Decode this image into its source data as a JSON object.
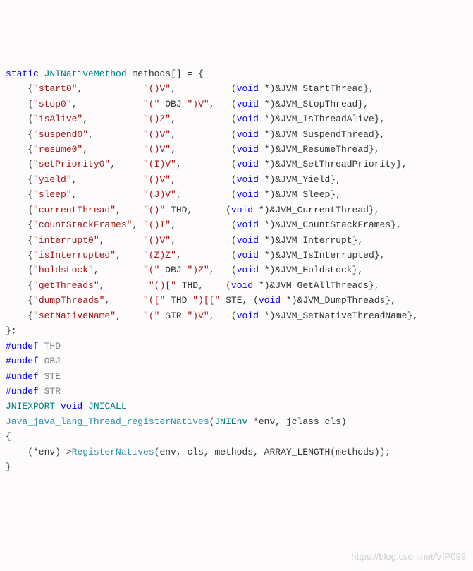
{
  "code": {
    "kw_static": "static",
    "type_jni": "JNINativeMethod",
    "methods_decl": " methods[] = {",
    "entries": [
      {
        "name": "\"start0\"",
        "pad1": "           ",
        "sig_pre": "\"()V\"",
        "sig_mid": "",
        "sig_post": "",
        "pad2": ",          (",
        "void": "void",
        "ptr": " *)&JVM_StartThread},"
      },
      {
        "name": "\"stop0\"",
        "pad1": "            ",
        "sig_pre": "\"(\"",
        "sig_mid": " OBJ ",
        "sig_post": "\")V\"",
        "pad2": ",   (",
        "void": "void",
        "ptr": " *)&JVM_StopThread},"
      },
      {
        "name": "\"isAlive\"",
        "pad1": "          ",
        "sig_pre": "\"()Z\"",
        "sig_mid": "",
        "sig_post": "",
        "pad2": ",          (",
        "void": "void",
        "ptr": " *)&JVM_IsThreadAlive},"
      },
      {
        "name": "\"suspend0\"",
        "pad1": "         ",
        "sig_pre": "\"()V\"",
        "sig_mid": "",
        "sig_post": "",
        "pad2": ",          (",
        "void": "void",
        "ptr": " *)&JVM_SuspendThread},"
      },
      {
        "name": "\"resume0\"",
        "pad1": "          ",
        "sig_pre": "\"()V\"",
        "sig_mid": "",
        "sig_post": "",
        "pad2": ",          (",
        "void": "void",
        "ptr": " *)&JVM_ResumeThread},"
      },
      {
        "name": "\"setPriority0\"",
        "pad1": "     ",
        "sig_pre": "\"(I)V\"",
        "sig_mid": "",
        "sig_post": "",
        "pad2": ",         (",
        "void": "void",
        "ptr": " *)&JVM_SetThreadPriority},"
      },
      {
        "name": "\"yield\"",
        "pad1": "            ",
        "sig_pre": "\"()V\"",
        "sig_mid": "",
        "sig_post": "",
        "pad2": ",          (",
        "void": "void",
        "ptr": " *)&JVM_Yield},"
      },
      {
        "name": "\"sleep\"",
        "pad1": "            ",
        "sig_pre": "\"(J)V\"",
        "sig_mid": "",
        "sig_post": "",
        "pad2": ",         (",
        "void": "void",
        "ptr": " *)&JVM_Sleep},"
      },
      {
        "name": "\"currentThread\"",
        "pad1": "    ",
        "sig_pre": "\"()\"",
        "sig_mid": " THD",
        "sig_post": "",
        "pad2": ",      (",
        "void": "void",
        "ptr": " *)&JVM_CurrentThread},"
      },
      {
        "name": "\"countStackFrames\"",
        "pad1": " ",
        "sig_pre": "\"()I\"",
        "sig_mid": "",
        "sig_post": "",
        "pad2": ",          (",
        "void": "void",
        "ptr": " *)&JVM_CountStackFrames},"
      },
      {
        "name": "\"interrupt0\"",
        "pad1": "       ",
        "sig_pre": "\"()V\"",
        "sig_mid": "",
        "sig_post": "",
        "pad2": ",          (",
        "void": "void",
        "ptr": " *)&JVM_Interrupt},"
      },
      {
        "name": "\"isInterrupted\"",
        "pad1": "    ",
        "sig_pre": "\"(Z)Z\"",
        "sig_mid": "",
        "sig_post": "",
        "pad2": ",         (",
        "void": "void",
        "ptr": " *)&JVM_IsInterrupted},"
      },
      {
        "name": "\"holdsLock\"",
        "pad1": "        ",
        "sig_pre": "\"(\"",
        "sig_mid": " OBJ ",
        "sig_post": "\")Z\"",
        "pad2": ",   (",
        "void": "void",
        "ptr": " *)&JVM_HoldsLock},"
      },
      {
        "name": "\"getThreads\"",
        "pad1": "        ",
        "sig_pre": "\"()[\"",
        "sig_mid": " THD",
        "sig_post": "",
        "pad2": ",    (",
        "void": "void",
        "ptr": " *)&JVM_GetAllThreads},"
      },
      {
        "name": "\"dumpThreads\"",
        "pad1": "      ",
        "sig_pre": "\"([\"",
        "sig_mid": " THD ",
        "sig_post": "\")[[\"",
        "sig_mid2": " STE, (",
        "void": "void",
        "ptr": " *)&JVM_DumpThreads},"
      },
      {
        "name": "\"setNativeName\"",
        "pad1": "    ",
        "sig_pre": "\"(\"",
        "sig_mid": " STR ",
        "sig_post": "\")V\"",
        "pad2": ",   (",
        "void": "void",
        "ptr": " *)&JVM_SetNativeThreadName},"
      }
    ],
    "close_brace": "};",
    "undef1_kw": "#undef",
    "undef1": " THD",
    "undef2_kw": "#undef",
    "undef2": " OBJ",
    "undef3_kw": "#undef",
    "undef3": " STE",
    "undef4_kw": "#undef",
    "undef4": " STR",
    "jniexport": "JNIEXPORT",
    "void_kw": "void",
    "jnicall": " JNICALL",
    "func_name": "Java_java_lang_Thread_registerNatives",
    "func_params_open": "(",
    "jnienv": "JNIEnv",
    "func_params_rest": " *env, jclass cls)",
    "open_brace": "{",
    "body_pre": "    (*env)->",
    "register_natives": "RegisterNatives",
    "body_post": "(env, cls, methods, ARRAY_LENGTH(methods));",
    "close_brace2": "}"
  },
  "watermark": "https://blog.csdn.net/VIP099"
}
